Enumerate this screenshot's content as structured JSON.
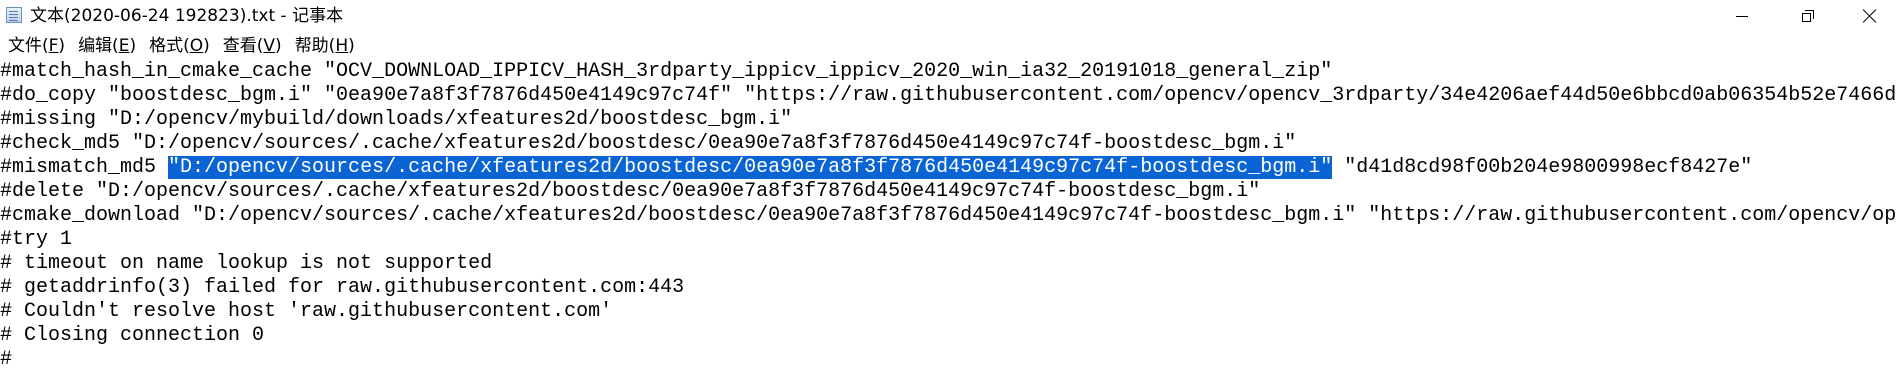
{
  "window": {
    "title": "文本(2020-06-24 192823).txt - 记事本",
    "icon": "notepad-icon",
    "controls": [
      "minimize-icon",
      "restore-icon",
      "close-icon"
    ]
  },
  "menu": {
    "file": {
      "label": "文件(",
      "mnemonic": "F",
      "suffix": ")"
    },
    "edit": {
      "label": "编辑(",
      "mnemonic": "E",
      "suffix": ")"
    },
    "format": {
      "label": "格式(",
      "mnemonic": "O",
      "suffix": ")"
    },
    "view": {
      "label": "查看(",
      "mnemonic": "V",
      "suffix": ")"
    },
    "help": {
      "label": "帮助(",
      "mnemonic": "H",
      "suffix": ")"
    }
  },
  "editor": {
    "selection_color": "#0a64d4",
    "lines": [
      "#match_hash_in_cmake_cache \"OCV_DOWNLOAD_IPPICV_HASH_3rdparty_ippicv_ippicv_2020_win_ia32_20191018_general_zip\"",
      "#do_copy \"boostdesc_bgm.i\" \"0ea90e7a8f3f7876d450e4149c97c74f\" \"https://raw.githubusercontent.com/opencv/opencv_3rdparty/34e4206aef44d50e6bbcd0ab06354b52e7466d",
      "#missing \"D:/opencv/mybuild/downloads/xfeatures2d/boostdesc_bgm.i\"",
      "#check_md5 \"D:/opencv/sources/.cache/xfeatures2d/boostdesc/0ea90e7a8f3f7876d450e4149c97c74f-boostdesc_bgm.i\"",
      {
        "before": "#mismatch_md5 ",
        "selected": "\"D:/opencv/sources/.cache/xfeatures2d/boostdesc/0ea90e7a8f3f7876d450e4149c97c74f-boostdesc_bgm.i\"",
        "after": " \"d41d8cd98f00b204e9800998ecf8427e\""
      },
      "#delete \"D:/opencv/sources/.cache/xfeatures2d/boostdesc/0ea90e7a8f3f7876d450e4149c97c74f-boostdesc_bgm.i\"",
      "#cmake_download \"D:/opencv/sources/.cache/xfeatures2d/boostdesc/0ea90e7a8f3f7876d450e4149c97c74f-boostdesc_bgm.i\" \"https://raw.githubusercontent.com/opencv/op",
      "#try 1",
      "# timeout on name lookup is not supported",
      "# getaddrinfo(3) failed for raw.githubusercontent.com:443",
      "# Couldn't resolve host 'raw.githubusercontent.com'",
      "# Closing connection 0",
      "#"
    ]
  }
}
